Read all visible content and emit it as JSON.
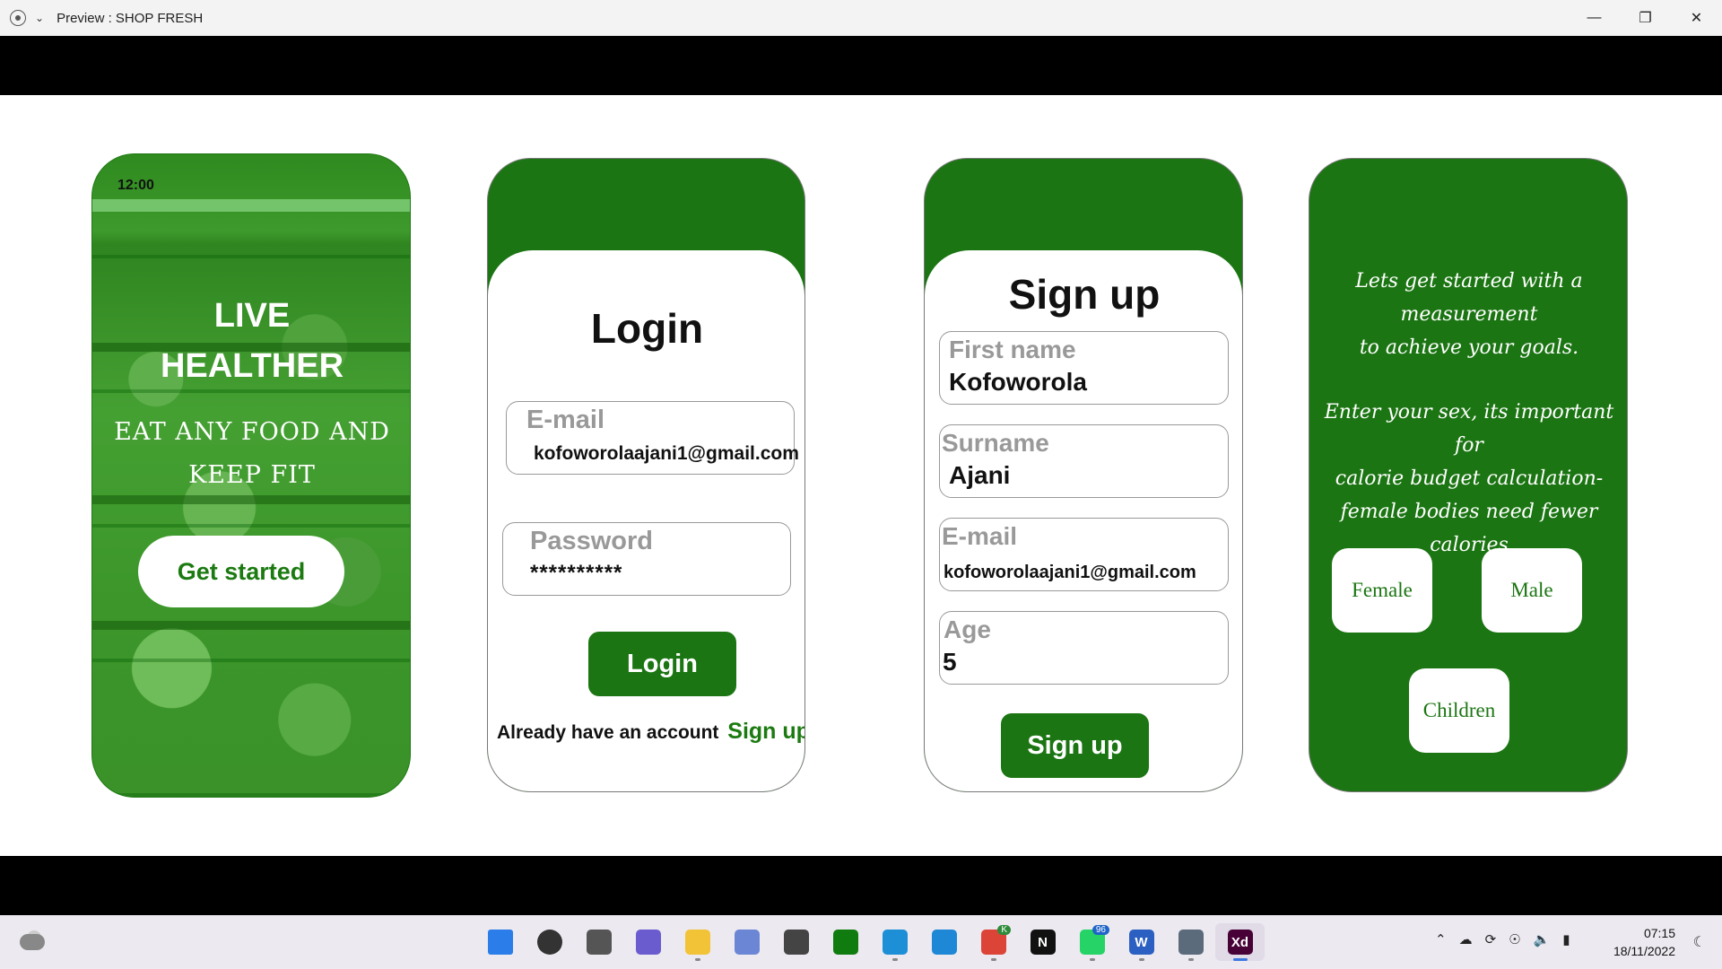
{
  "window": {
    "title": "Preview : SHOP FRESH",
    "controls": [
      "minimize",
      "restore",
      "close"
    ]
  },
  "screen1": {
    "time": "12:00",
    "headline_line1": "LIVE",
    "headline_line2": "HEALTHER",
    "subline_line1": "EAT ANY FOOD AND",
    "subline_line2": "KEEP FIT",
    "button": "Get started"
  },
  "screen2": {
    "heading": "Login",
    "email_label": "E-mail",
    "email_value": "kofoworolaajani1@gmail.com",
    "password_label": "Password",
    "password_value": "**********",
    "login_button": "Login",
    "already_text": "Already have an account",
    "signup_link": "Sign up"
  },
  "screen3": {
    "heading": "Sign up",
    "first_label": "First name",
    "first_value": "Kofoworola",
    "surname_label": "Surname",
    "surname_value": "Ajani",
    "email_label": "E-mail",
    "email_value": "kofoworolaajani1@gmail.com",
    "age_label": "Age",
    "age_value": "5",
    "signup_button": "Sign up"
  },
  "screen4": {
    "intro_line1": "Lets get started with a",
    "intro_line2": "measurement",
    "intro_line3": "to achieve your goals.",
    "note_line1": "Enter your sex, its important for",
    "note_line2": "calorie budget calculation-",
    "note_line3": "female bodies need fewer",
    "note_line4": "calories",
    "option_female": "Female",
    "option_male": "Male",
    "option_children": "Children"
  },
  "taskbar": {
    "apps": [
      {
        "name": "start",
        "glyph": "",
        "color": "#2b7de9"
      },
      {
        "name": "search",
        "glyph": "",
        "color": "#333333"
      },
      {
        "name": "task-view",
        "glyph": "",
        "color": "#555555"
      },
      {
        "name": "teams-chat",
        "glyph": "",
        "color": "#6a5ccf"
      },
      {
        "name": "file-explorer",
        "glyph": "",
        "color": "#f2c237"
      },
      {
        "name": "photos",
        "glyph": "",
        "color": "#6c86d6"
      },
      {
        "name": "microsoft-store",
        "glyph": "",
        "color": "#444444"
      },
      {
        "name": "xbox",
        "glyph": "",
        "color": "#107c10"
      },
      {
        "name": "edge",
        "glyph": "",
        "color": "#1d8fd6"
      },
      {
        "name": "vscode",
        "glyph": "",
        "color": "#1e88d6"
      },
      {
        "name": "chrome",
        "glyph": "",
        "color": "#db4437"
      },
      {
        "name": "netflix",
        "glyph": "N",
        "color": "#111111"
      },
      {
        "name": "whatsapp",
        "glyph": "",
        "color": "#25d366"
      },
      {
        "name": "word",
        "glyph": "W",
        "color": "#2b5fc1"
      },
      {
        "name": "settings",
        "glyph": "",
        "color": "#5b6b7c"
      },
      {
        "name": "adobe-xd",
        "glyph": "Xd",
        "color": "#470137"
      }
    ],
    "whatsapp_badge": "96",
    "chrome_badge": "K",
    "time": "07:15",
    "date": "18/11/2022"
  }
}
